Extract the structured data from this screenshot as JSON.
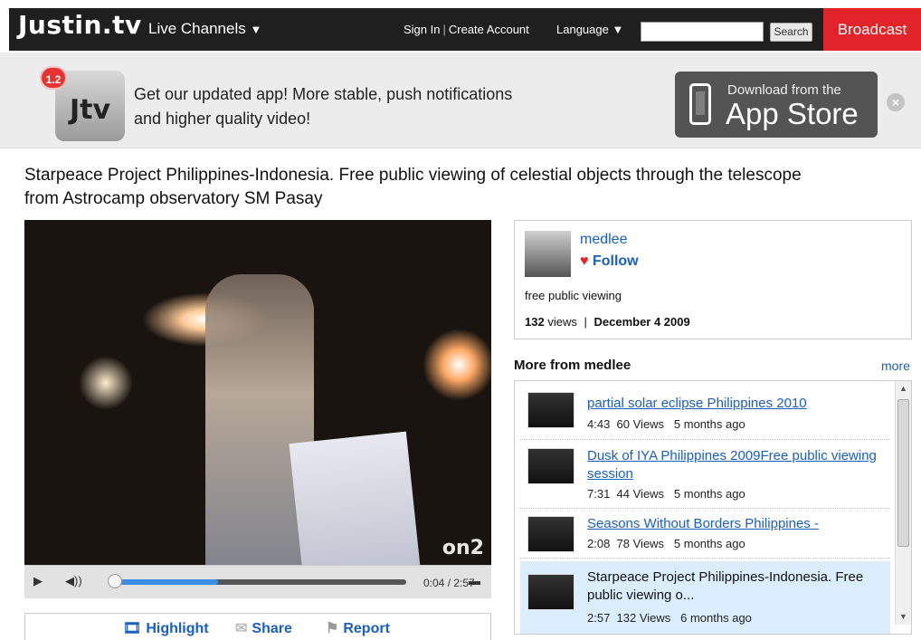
{
  "nav": {
    "logo": "Justin.tv",
    "live_channels": "Live Channels",
    "sign_in": "Sign In",
    "create_account": "Create Account",
    "language": "Language",
    "search_button": "Search",
    "broadcast": "Broadcast"
  },
  "banner": {
    "badge": "1.2",
    "app_icon_text": "Jtv",
    "message": "Get our updated app! More stable, push notifications and higher quality video!",
    "download_from": "Download from the",
    "app_store": "App Store"
  },
  "video": {
    "title": "Starpeace Project Philippines-Indonesia. Free public viewing of celestial objects through the telescope from Astrocamp observatory SM Pasay",
    "watermark": "on2",
    "time": "0:04 / 2:57",
    "progress": 0.36
  },
  "actions": {
    "highlight": "Highlight",
    "share": "Share",
    "report": "Report"
  },
  "channel": {
    "username": "medlee",
    "follow": "Follow",
    "description": "free public viewing",
    "views": "132",
    "views_label": "views",
    "date": "December 4 2009"
  },
  "more": {
    "heading": "More from medlee",
    "link": "more",
    "items": [
      {
        "title": "partial solar eclipse Philippines 2010",
        "duration": "4:43",
        "views": "60 Views",
        "age": "5 months  ago"
      },
      {
        "title": "Dusk of IYA Philippines 2009Free public viewing session",
        "duration": "7:31",
        "views": "44 Views",
        "age": "5 months  ago"
      },
      {
        "title": "Seasons Without Borders Philippines -",
        "duration": "2:08",
        "views": "78 Views",
        "age": "5 months  ago"
      },
      {
        "title": "Starpeace Project Philippines-Indonesia. Free public viewing o...",
        "duration": "2:57",
        "views": "132 Views",
        "age": "6 months  ago"
      }
    ]
  },
  "colors": {
    "accent": "#e0242a",
    "link": "#1a5fbf",
    "nav_bg": "#1f1f1f"
  }
}
